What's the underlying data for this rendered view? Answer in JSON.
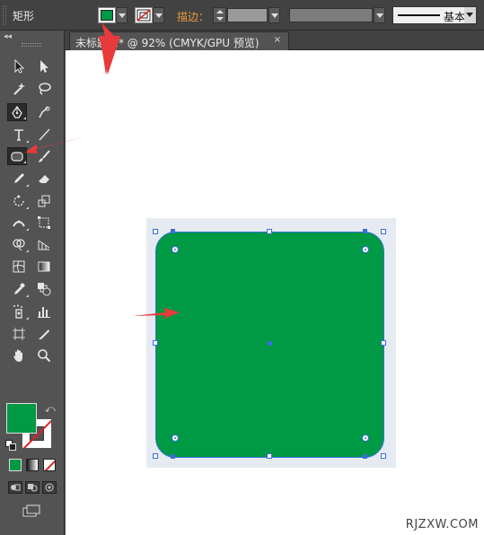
{
  "control_bar": {
    "tool_name": "矩形",
    "fill_color": "#009944",
    "stroke_label": "描边：",
    "brush_definition": "基本"
  },
  "document_tab": {
    "title": "未标题-1* @ 92% (CMYK/GPU 预览)",
    "close": "×"
  },
  "toolbar": {
    "collapse": "◂◂",
    "fill_color": "#009944",
    "stroke_color": "none",
    "tools": [
      "selection-icon",
      "direct-selection-icon",
      "magic-wand-icon",
      "lasso-icon",
      "pen-icon",
      "curvature-icon",
      "type-icon",
      "line-segment-icon",
      "rounded-rectangle-icon",
      "paintbrush-icon",
      "pencil-icon",
      "eraser-icon",
      "rotate-icon",
      "scale-icon",
      "width-icon",
      "free-transform-icon",
      "shape-builder-icon",
      "perspective-grid-icon",
      "mesh-icon",
      "gradient-icon",
      "eyedropper-icon",
      "blend-icon",
      "symbol-sprayer-icon",
      "column-graph-icon",
      "artboard-icon",
      "slice-icon",
      "hand-icon",
      "zoom-icon"
    ]
  },
  "canvas": {
    "shape_fill": "#009944",
    "selection_color": "#3a6fd8",
    "watermark": "RJZXW.COM"
  },
  "annotations": {
    "arrow_color": "#e83a3a"
  }
}
